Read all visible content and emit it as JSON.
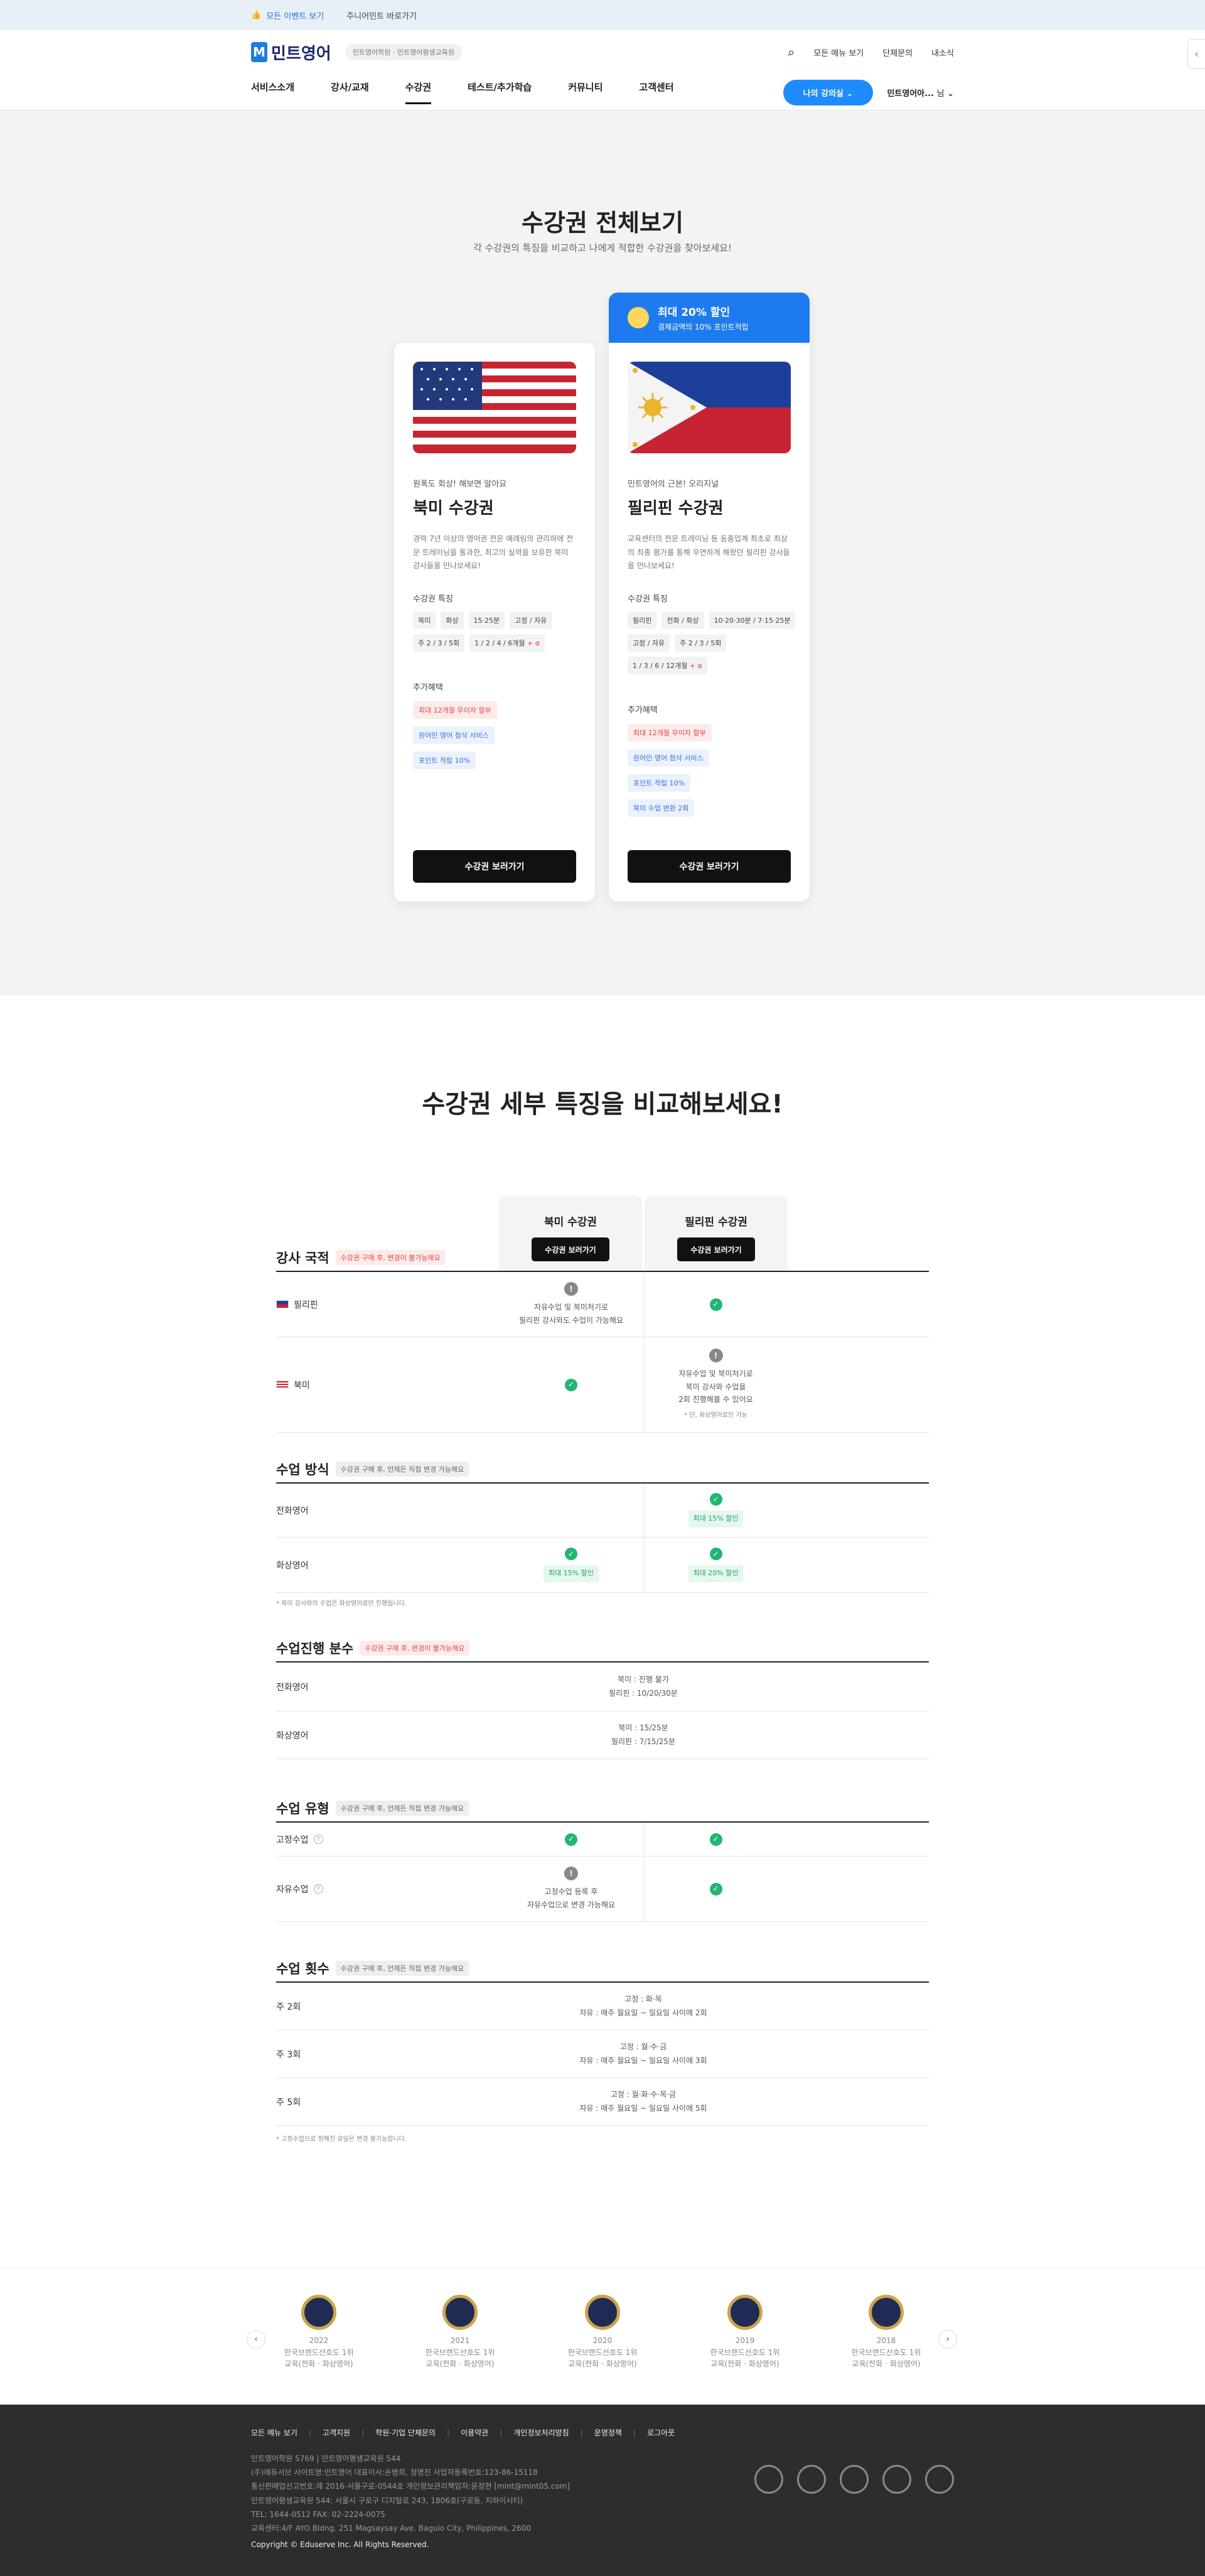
{
  "topbar": {
    "event_link": "모든 이벤트 보기",
    "junior_link": "주니어민트 바로가기"
  },
  "header": {
    "logo": "민트영어",
    "cert": "민트영어학원 · 민트영어평생교육원",
    "all_menu": "모든 메뉴 보기",
    "group_inquiry": "단체문의",
    "my_notes": "내소식",
    "nav": [
      "서비스소개",
      "강사/교재",
      "수강권",
      "테스트/추가학습",
      "커뮤니티",
      "고객센터"
    ],
    "my_class": "나의 강의실",
    "user_name": "민트영어아...",
    "user_suffix": "님"
  },
  "hero": {
    "title": "수강권 전체보기",
    "subtitle": "각 수강권의 특징을 비교하고 나에게 적합한 수강권을 찾아보세요!",
    "badge": {
      "title": "최대 20% 할인",
      "sub": "결제금액의 10% 포인트적립"
    },
    "cards": [
      {
        "eyebrow": "원폭도 회상! 해보면 알아요",
        "title": "북미 수강권",
        "desc": "경력 7년 이상의 영어권 전문 예례림의 관리하에 전문 트레이닝을 통과한, 최고의 실력을 보유한 북미 강사들을 만나보세요!",
        "features_label": "수강권 특징",
        "features": [
          "북미",
          "화상",
          "15·25분",
          "고정 / 자유",
          "주 2 / 3 / 5회",
          "1 / 2 / 4 / 6개월"
        ],
        "more": "+ α",
        "benefits_label": "추가혜택",
        "benefits": [
          "최대 12개월 무이자 할부",
          "원어민 영어 첨삭 서비스",
          "포인트 적립 10%"
        ],
        "button": "수강권 보러가기"
      },
      {
        "eyebrow": "민트영어의 근본! 오리지널",
        "title": "필리핀 수강권",
        "desc": "교육센터의 전문 트레이닝 등 동종업계 최초로 최상의 최종 평가를 통해 우연하게 해왔던 필리핀 강사들을 만나보세요!",
        "features_label": "수강권 특징",
        "features": [
          "필리핀",
          "전화 / 화상",
          "10·20·30분 / 7·15·25분",
          "고정 / 자유",
          "주 2 / 3 / 5회",
          "1 / 3 / 6 / 12개월"
        ],
        "more": "+ α",
        "benefits_label": "추가혜택",
        "benefits": [
          "최대 12개월 무이자 할부",
          "원어민 영어 첨삭 서비스",
          "포인트 적립 10%",
          "북미 수업 변환 2회"
        ],
        "button": "수강권 보러가기"
      }
    ]
  },
  "compare": {
    "title": "수강권 세부 특징을 비교해보세요!",
    "columns": [
      {
        "name": "북미 수강권",
        "button": "수강권 보러가기"
      },
      {
        "name": "필리핀 수강권",
        "button": "수강권 보러가기"
      }
    ],
    "groups": {
      "nation": {
        "title": "강사 국적",
        "tag": "수강권 구매 후, 변경이 불가능해요",
        "rows": [
          {
            "label": "필리핀",
            "c1": "자유수업 및 북미처기로\n필리핀 강사와도 수업이 가능해요"
          },
          {
            "label": "북미",
            "c2": "자유수업 및 북미처기로\n북미 강사와 수업을\n2회 진행해볼 수 있어요",
            "c2_note": "* 단, 화상영어로만 가능"
          }
        ]
      },
      "method": {
        "title": "수업 방식",
        "tag": "수강권 구매 후, 언제든 직접 변경 가능해요",
        "rows": [
          {
            "label": "전화영어",
            "c2_disc": "최대 15% 할인"
          },
          {
            "label": "화상영어",
            "c1_disc": "최대 15% 할인",
            "c2_disc": "최대 20% 할인"
          }
        ],
        "note": "* 북미 강사와의 수업은 화상영어로만 진행됩니다."
      },
      "duration": {
        "title": "수업진행 분수",
        "tag": "수강권 구매 후, 변경이 불가능해요",
        "rows": [
          {
            "label": "전화영어",
            "l1": "북미 : 진행 불가",
            "l2": "필리핀 : 10/20/30분"
          },
          {
            "label": "화상영어",
            "l1": "북미 : 15/25분",
            "l2": "필리핀 : 7/15/25분"
          }
        ]
      },
      "type": {
        "title": "수업 유형",
        "tag": "수강권 구매 후, 언제든 직접 변경 가능해요",
        "rows": [
          {
            "label": "고정수업"
          },
          {
            "label": "자유수업",
            "c1": "고정수업 등록 후\n자유수업으로 변경 가능해요"
          }
        ]
      },
      "count": {
        "title": "수업 횟수",
        "tag": "수강권 구매 후, 언제든 직접 변경 가능해요",
        "rows": [
          {
            "label": "주 2회",
            "l1": "고정 : 화·목",
            "l2": "자유 : 매주 월요일 ~ 일요일 사이에 2회"
          },
          {
            "label": "주 3회",
            "l1": "고정 : 월·수·금",
            "l2": "자유 : 매주 월요일 ~ 일요일 사이에 3회"
          },
          {
            "label": "주 5회",
            "l1": "고정 : 월·화·수·목·금",
            "l2": "자유 : 매주 월요일 ~ 일요일 사이에 5회"
          }
        ],
        "note": "* 고정수업으로 정해진 요일은 변경 불가능합니다."
      }
    }
  },
  "awards": [
    {
      "year": "2022",
      "l1": "한국브랜드선호도 1위",
      "l2": "교육(전화 · 화상영어)"
    },
    {
      "year": "2021",
      "l1": "한국브랜드선호도 1위",
      "l2": "교육(전화 · 화상영어)"
    },
    {
      "year": "2020",
      "l1": "한국브랜드선호도 1위",
      "l2": "교육(전화 · 화상영어)"
    },
    {
      "year": "2019",
      "l1": "한국브랜드선호도 1위",
      "l2": "교육(전화 · 화상영어)"
    },
    {
      "year": "2018",
      "l1": "한국브랜드선호도 1위",
      "l2": "교육(전화 · 화상영어)"
    }
  ],
  "footer": {
    "links": [
      "모든 메뉴 보기",
      "고객지원",
      "학원·기업 단체문의",
      "이용약관",
      "개인정보처리방침",
      "운영정책",
      "로그아웃"
    ],
    "info": [
      "민트영어학원 5769 | 민트영어평생교육원 544",
      "(주)에듀서브 사이트명:민트영어 대표이사:손병희, 정명진 사업자등록번호:123-86-15118",
      "통신판매업신고번호:제 2016-서울구로-0544호 개인정보관리책임자:윤정현 [mint@mint05.com]",
      "민트영어평생교육원 544: 서울시 구로구 디지털로 243, 1806호(구로동, 지하이시티)",
      "TEL: 1644-0512 FAX: 02-2224-0075",
      "교육센터:4/F AYO Bldng. 251 Magsaysay Ave. Baguio City, Philippines, 2600"
    ],
    "copyright": "Copyright © Eduserve Inc. All Rights Reserved."
  },
  "colors": {
    "accent": "#1e7bef",
    "check": "#22b573",
    "dark": "#111111",
    "footer_bg": "#2d2d2d"
  }
}
